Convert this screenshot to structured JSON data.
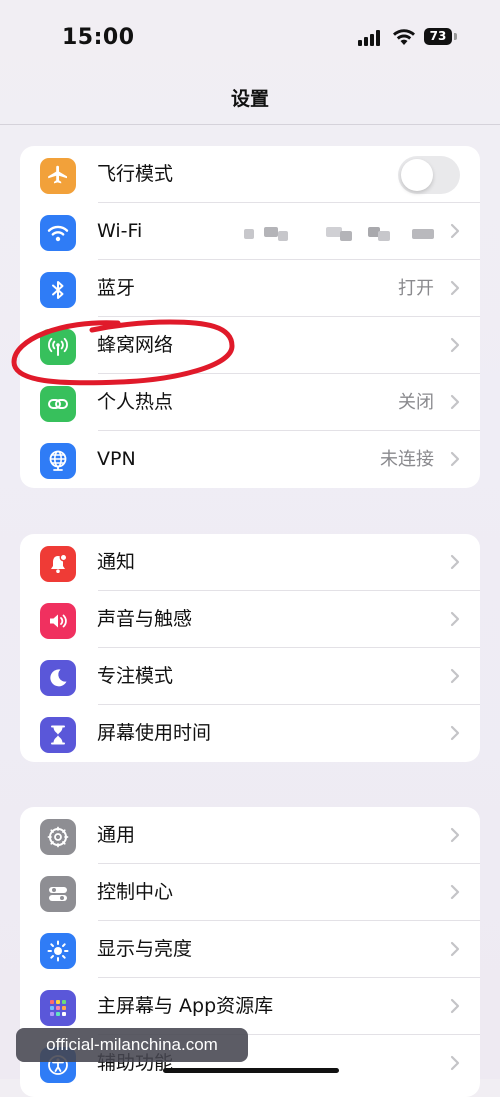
{
  "status_bar": {
    "time": "15:00",
    "battery": "73"
  },
  "nav": {
    "title": "设置"
  },
  "group1": [
    {
      "label": "飞行模式",
      "icon": "airplane-icon",
      "color": "#f2a13a",
      "control": "toggle",
      "toggle_on": false
    },
    {
      "label": "Wi-Fi",
      "icon": "wifi-icon",
      "color": "#2f7cf6",
      "value": "",
      "redacted": true
    },
    {
      "label": "蓝牙",
      "icon": "bluetooth-icon",
      "color": "#2f7cf6",
      "value": "打开"
    },
    {
      "label": "蜂窝网络",
      "icon": "antenna-icon",
      "color": "#37c05c",
      "value": ""
    },
    {
      "label": "个人热点",
      "icon": "hotspot-icon",
      "color": "#37c05c",
      "value": "关闭"
    },
    {
      "label": "VPN",
      "icon": "globe-icon",
      "color": "#2f7cf6",
      "value": "未连接"
    }
  ],
  "group2": [
    {
      "label": "通知",
      "icon": "bell-icon",
      "color": "#ef3b36",
      "value": ""
    },
    {
      "label": "声音与触感",
      "icon": "speaker-icon",
      "color": "#f0305f",
      "value": ""
    },
    {
      "label": "专注模式",
      "icon": "moon-icon",
      "color": "#5a57d9",
      "value": ""
    },
    {
      "label": "屏幕使用时间",
      "icon": "hourglass-icon",
      "color": "#5a57d9",
      "value": ""
    }
  ],
  "group3": [
    {
      "label": "通用",
      "icon": "gear-icon",
      "color": "#8e8e93",
      "value": ""
    },
    {
      "label": "控制中心",
      "icon": "switches-icon",
      "color": "#8e8e93",
      "value": ""
    },
    {
      "label": "显示与亮度",
      "icon": "sun-icon",
      "color": "#2f7cf6",
      "value": ""
    },
    {
      "label": "主屏幕与 App资源库",
      "icon": "app-grid-icon",
      "color": "#5a57d9",
      "value": ""
    },
    {
      "label": "辅助功能",
      "icon": "accessibility-icon",
      "color": "#2f7cf6",
      "value": ""
    }
  ],
  "watermark": "official-milanchina.com",
  "annotation": {
    "color": "#e01a2a",
    "target": "蜂窝网络"
  }
}
